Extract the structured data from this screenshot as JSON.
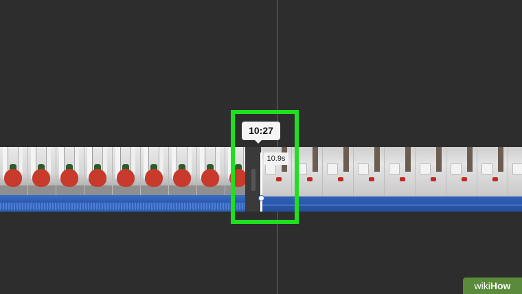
{
  "tooltip": {
    "time": "10:27"
  },
  "clip": {
    "duration": "10.9s"
  },
  "watermark": {
    "wiki": "wiki",
    "how": "How"
  },
  "colors": {
    "background": "#2d2d2d",
    "highlight": "#1fe01f",
    "audio": "#2f61b8",
    "watermark": "#5a8a3a"
  }
}
